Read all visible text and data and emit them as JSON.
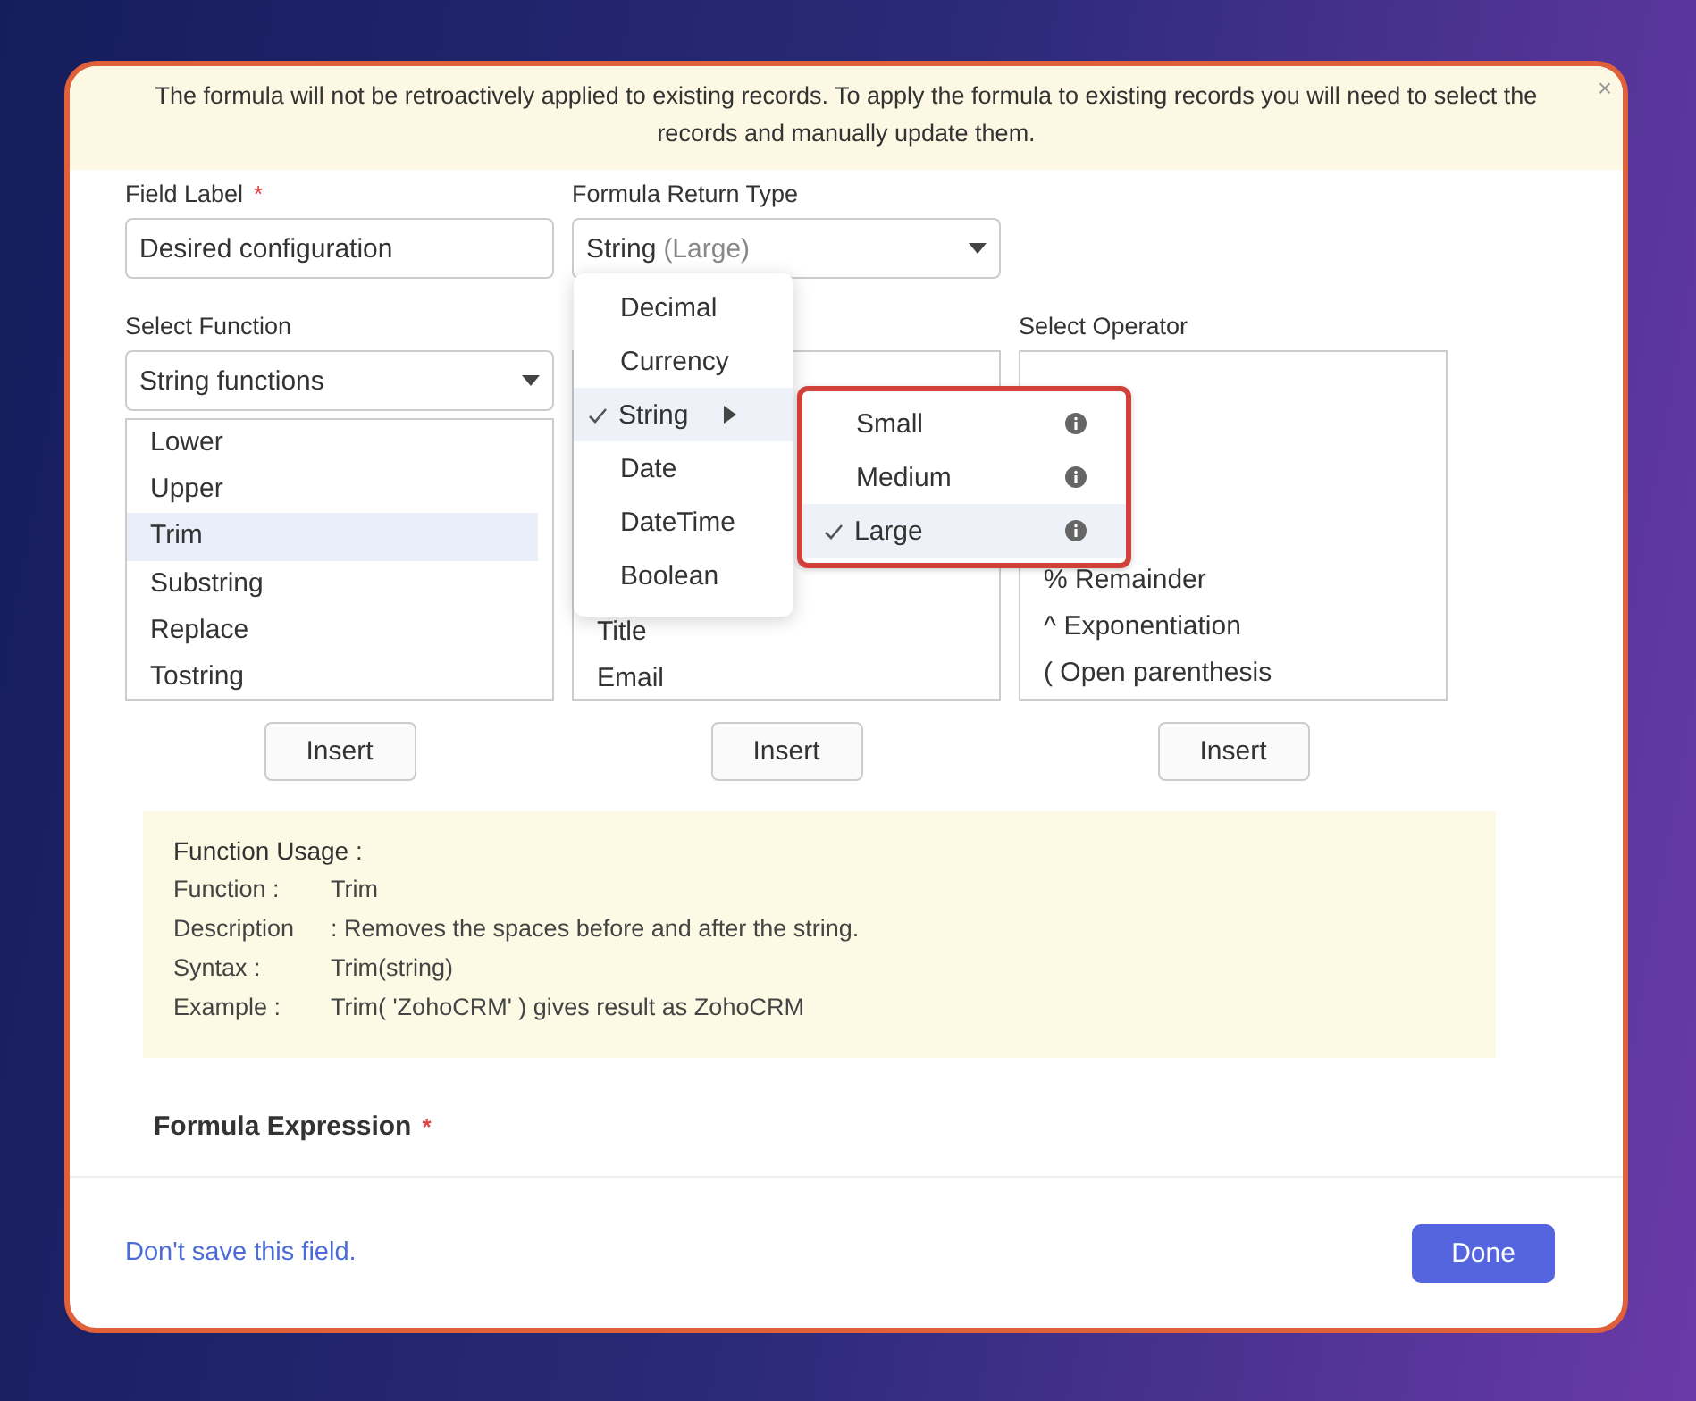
{
  "banner": {
    "text": "The formula will not be retroactively applied to existing records. To apply the formula to existing records you will need to select the records and manually update them.",
    "close": "×"
  },
  "field_label": {
    "label": "Field Label",
    "required_mark": "*",
    "value": "Desired configuration"
  },
  "return_type": {
    "label": "Formula Return Type",
    "value": "String",
    "value_suffix": "(Large)"
  },
  "return_type_menu": [
    {
      "label": "Decimal",
      "selected": false
    },
    {
      "label": "Currency",
      "selected": false
    },
    {
      "label": "String",
      "selected": true,
      "submenu": [
        {
          "label": "Small",
          "selected": false
        },
        {
          "label": "Medium",
          "selected": false
        },
        {
          "label": "Large",
          "selected": true
        }
      ]
    },
    {
      "label": "Date",
      "selected": false
    },
    {
      "label": "DateTime",
      "selected": false
    },
    {
      "label": "Boolean",
      "selected": false
    }
  ],
  "columns": [
    {
      "label": "Select Function",
      "dropdown": "String functions",
      "items": [
        {
          "label": "Lower",
          "selected": false
        },
        {
          "label": "Upper",
          "selected": false
        },
        {
          "label": "Trim",
          "selected": true
        },
        {
          "label": "Substring",
          "selected": false
        },
        {
          "label": "Replace",
          "selected": false
        },
        {
          "label": "Tostring",
          "selected": false
        }
      ],
      "button": "Insert"
    },
    {
      "items": [
        {
          "label": "Title",
          "selected": false
        },
        {
          "label": "Email",
          "selected": false
        }
      ],
      "button": "Insert"
    },
    {
      "label": "Select Operator",
      "items": [
        {
          "label": "% Remainder",
          "selected": false
        },
        {
          "label": "^ Exponentiation",
          "selected": false
        },
        {
          "label": "( Open parenthesis",
          "selected": false
        }
      ],
      "button": "Insert"
    }
  ],
  "usage": {
    "title": "Function Usage :",
    "rows": [
      {
        "key": "Function :",
        "value": "Trim"
      },
      {
        "key": "Description",
        "value": ": Removes the spaces before and after the string."
      },
      {
        "key": "Syntax :",
        "value": "Trim(string)"
      },
      {
        "key": "Example :",
        "value": "Trim( 'ZohoCRM' ) gives result as ZohoCRM"
      }
    ]
  },
  "formula_expression": {
    "label": "Formula Expression",
    "required_mark": "*"
  },
  "footer": {
    "link": "Don't save this field.",
    "button": "Done"
  }
}
